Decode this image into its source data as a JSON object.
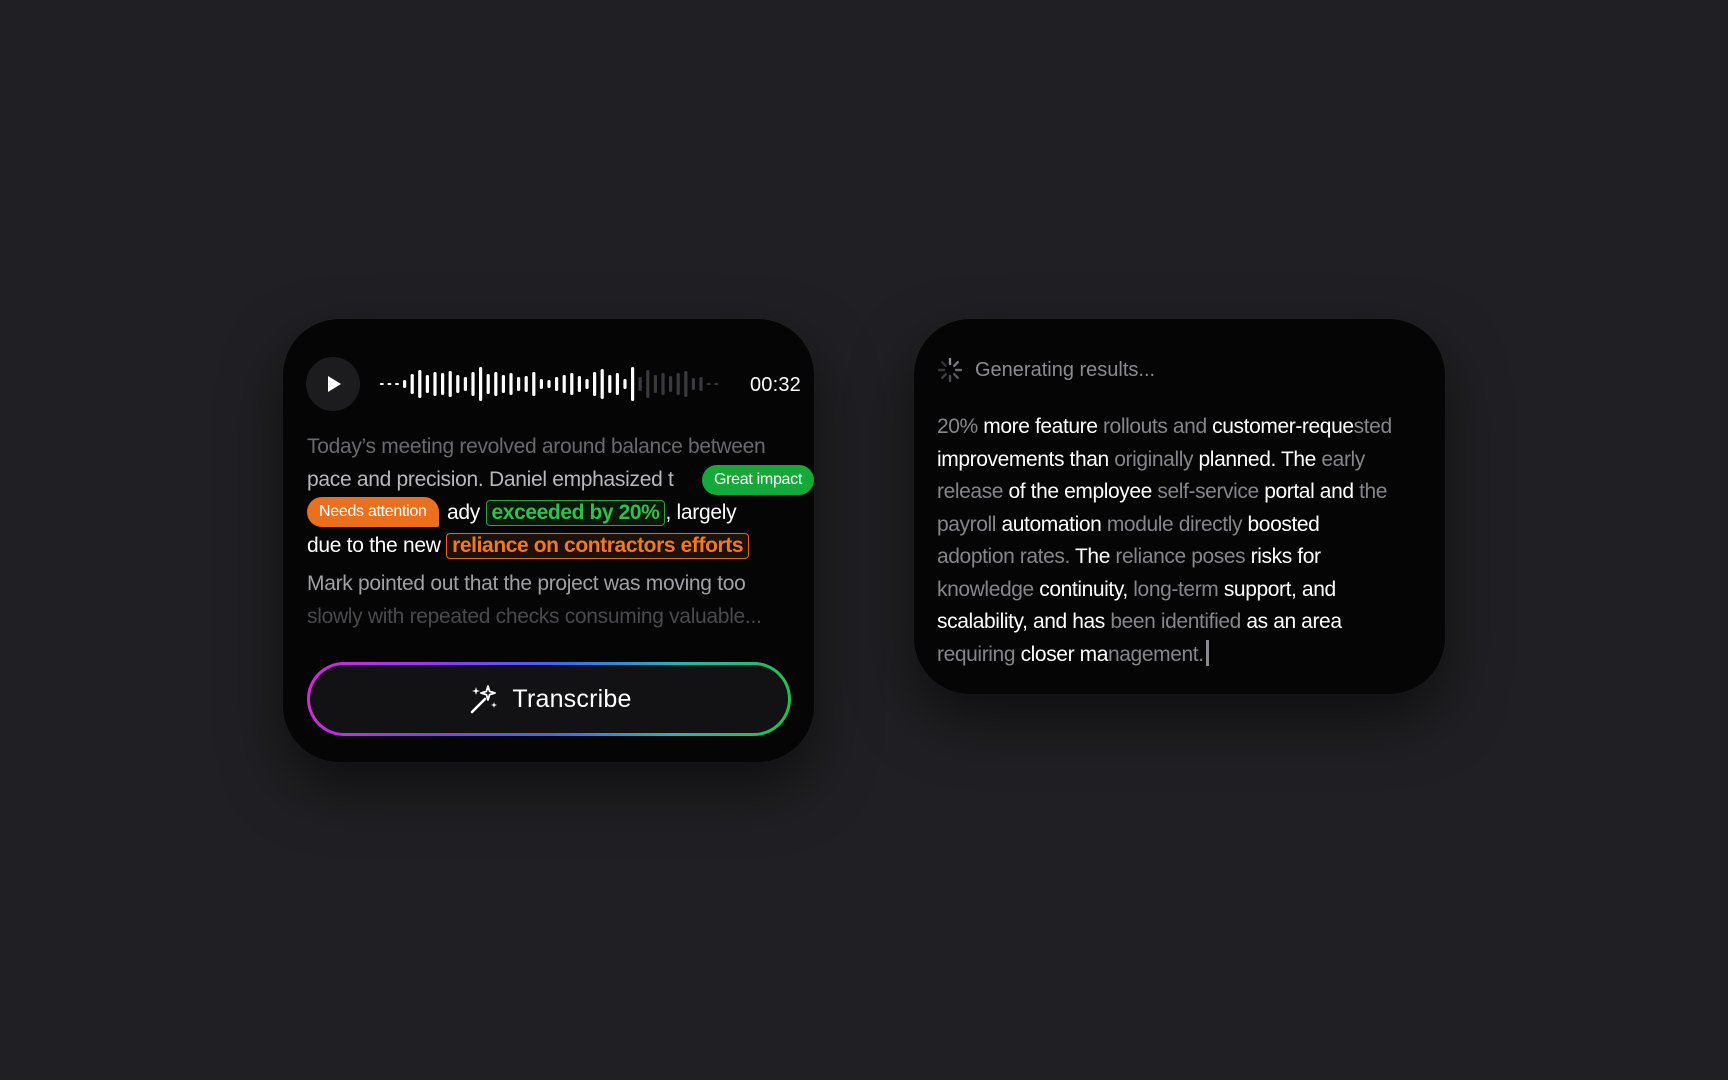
{
  "player": {
    "play_label": "Play",
    "time": "00:32"
  },
  "transcript": {
    "line1": "Today’s meeting revolved around balance between",
    "line2": "pace and precision. Daniel emphasized t",
    "line3_tail": "ady",
    "highlight_green": "exceeded by 20%",
    "line3_after": ", largely",
    "line4_pre": "due to the new",
    "highlight_orange": "reliance on contractors efforts",
    "line5": "Mark pointed out that the project was moving too",
    "line6": "slowly with repeated checks consuming valuable..."
  },
  "tags": {
    "great_impact": "Great impact",
    "needs_attention": "Needs attention"
  },
  "actions": {
    "transcribe_label": "Transcribe"
  },
  "results": {
    "status": "Generating results...",
    "segments": [
      [
        [
          "g",
          "20% "
        ],
        [
          "b",
          "more feature "
        ],
        [
          "g",
          "rollouts and "
        ],
        [
          "b",
          "customer-reque"
        ],
        [
          "g",
          "sted"
        ]
      ],
      [
        [
          "b",
          "improvements than "
        ],
        [
          "g",
          "originally "
        ],
        [
          "b",
          "planned. The "
        ],
        [
          "g",
          "early"
        ]
      ],
      [
        [
          "g",
          "release "
        ],
        [
          "b",
          "of the employee "
        ],
        [
          "g",
          "self-service "
        ],
        [
          "b",
          "portal and "
        ],
        [
          "g",
          "the"
        ]
      ],
      [
        [
          "g",
          "payroll "
        ],
        [
          "b",
          "automation "
        ],
        [
          "g",
          "module directly "
        ],
        [
          "b",
          "boosted"
        ]
      ],
      [
        [
          "g",
          "adoption rates. "
        ],
        [
          "b",
          "The "
        ],
        [
          "g",
          "reliance poses "
        ],
        [
          "b",
          "risks for"
        ]
      ],
      [
        [
          "g",
          "knowledge "
        ],
        [
          "b",
          "continuity, "
        ],
        [
          "g",
          "long-term "
        ],
        [
          "b",
          "support, and"
        ]
      ],
      [
        [
          "b",
          "scalability, and has "
        ],
        [
          "g",
          "been identified "
        ],
        [
          "b",
          "as an area"
        ]
      ],
      [
        [
          "g",
          "requiring "
        ],
        [
          "b",
          "closer ma"
        ],
        [
          "g",
          "nagement."
        ]
      ]
    ]
  },
  "colors": {
    "background": "#202024",
    "card": "#050505",
    "green": "#2ec24a",
    "orange": "#ee7a26"
  }
}
